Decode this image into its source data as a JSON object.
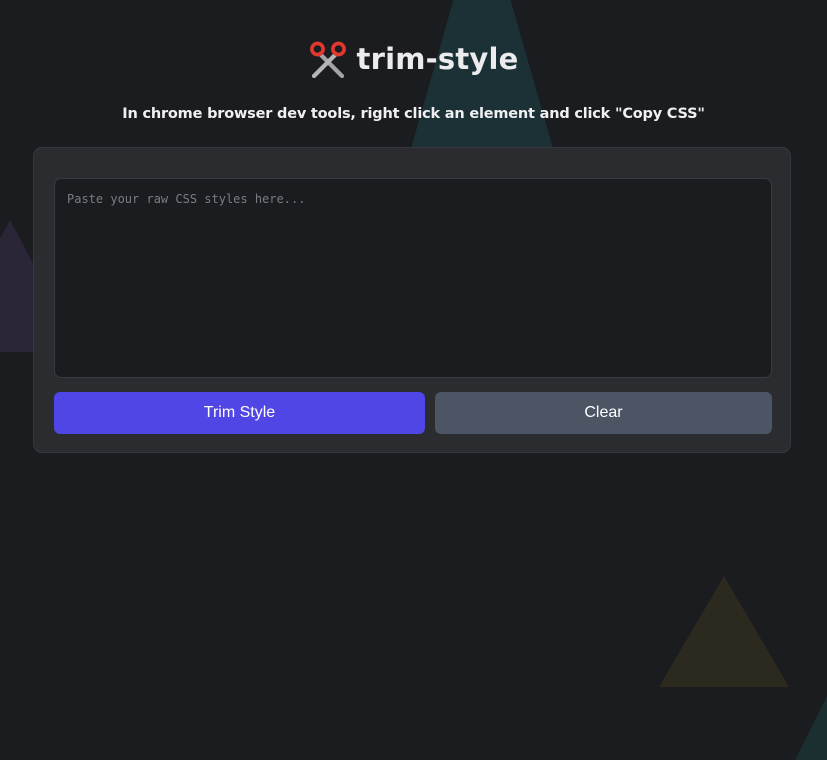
{
  "app": {
    "title": "trim-style",
    "logo_icon": "scissors-icon",
    "subtitle": "In chrome browser dev tools, right click an element and click \"Copy CSS\""
  },
  "editor": {
    "value": "",
    "placeholder": "Paste your raw CSS styles here..."
  },
  "actions": {
    "trim_label": "Trim Style",
    "clear_label": "Clear"
  },
  "colors": {
    "background": "#1b1c1f",
    "card": "#2b2c30",
    "primary": "#5046e5",
    "secondary": "#4b5563",
    "scissors_handles": "#e0382c",
    "scissors_blades": "#9a9aa0"
  }
}
